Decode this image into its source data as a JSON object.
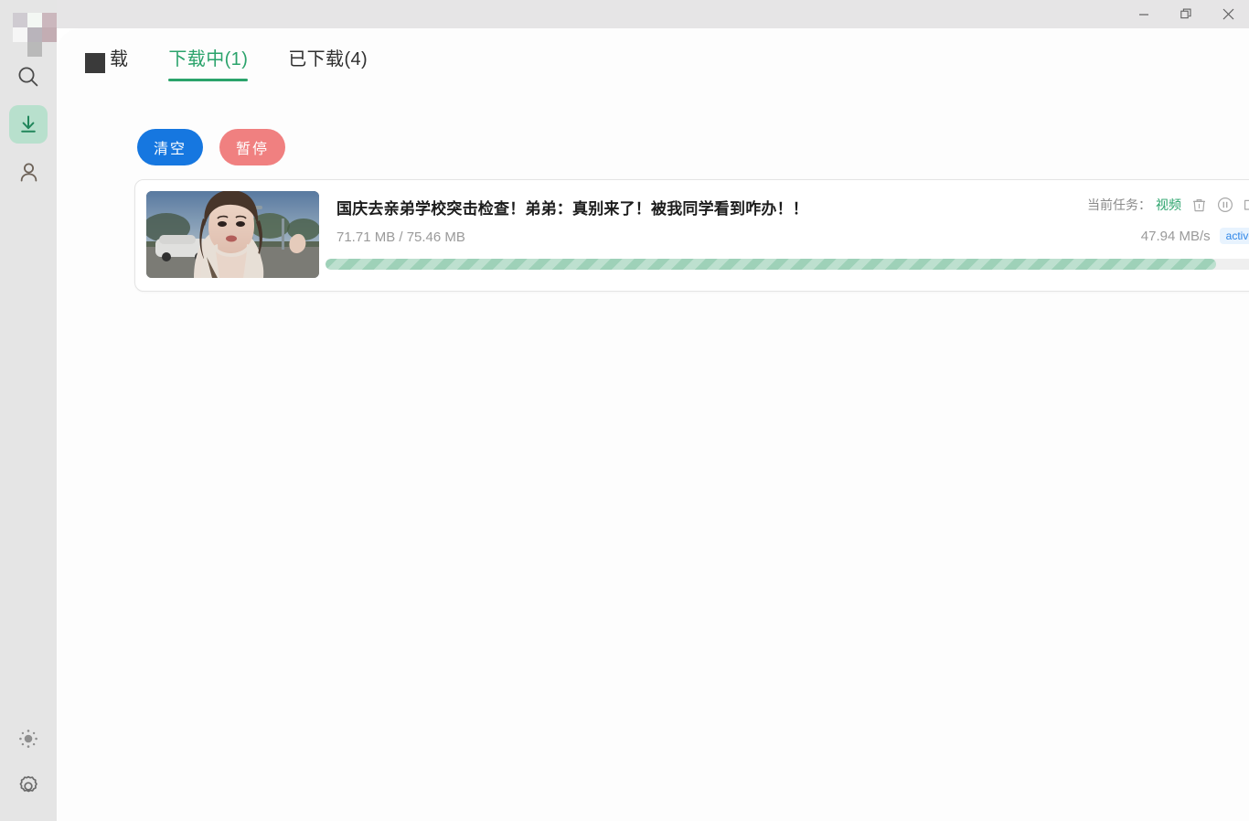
{
  "window": {
    "controls": [
      {
        "name": "minimize",
        "label": "—"
      },
      {
        "name": "restore",
        "label": "❐"
      },
      {
        "name": "close",
        "label": "✕"
      }
    ]
  },
  "sidebar": {
    "background_color": "#e5e5e5",
    "active_color": "#b8e0cd",
    "top_items": [
      {
        "name": "search",
        "icon": "search-icon",
        "active": false
      },
      {
        "name": "downloads",
        "icon": "download-icon",
        "active": true
      },
      {
        "name": "account",
        "icon": "person-icon",
        "active": false
      }
    ],
    "bottom_items": [
      {
        "name": "theme",
        "icon": "brightness-sun-icon",
        "active": false
      },
      {
        "name": "settings",
        "icon": "gear-icon",
        "active": false
      }
    ]
  },
  "tabs": [
    {
      "label": "载",
      "active": false,
      "obscured": true
    },
    {
      "label": "下载中(1)",
      "active": true,
      "obscured": false
    },
    {
      "label": "已下载(4)",
      "active": false,
      "obscured": false
    }
  ],
  "toolbar": {
    "clear_label": "清空",
    "pause_label": "暂停",
    "clear_color": "#1677e0",
    "pause_color": "#f08080"
  },
  "download": {
    "title": "国庆去亲弟学校突击检查！弟弟：真别来了！被我同学看到咋办！！",
    "size_text": "71.71 MB / 75.46 MB",
    "downloaded": "71.71 MB",
    "total": "75.46 MB",
    "task_label": "当前任务：",
    "task_value": "视频",
    "speed": "47.94 MB/s",
    "status_badge": "active",
    "progress_percent": 95,
    "progress_color": "#9ed1b8",
    "badge_text_color": "#2f86e8",
    "badge_bg_color": "#e8f3fe",
    "row_icons": [
      {
        "name": "delete-icon",
        "title": "delete"
      },
      {
        "name": "pause-icon",
        "title": "pause"
      },
      {
        "name": "folder-icon",
        "title": "open folder"
      }
    ]
  },
  "accent": {
    "green": "#2aa36b",
    "blue": "#1677e0",
    "red": "#f08080"
  }
}
